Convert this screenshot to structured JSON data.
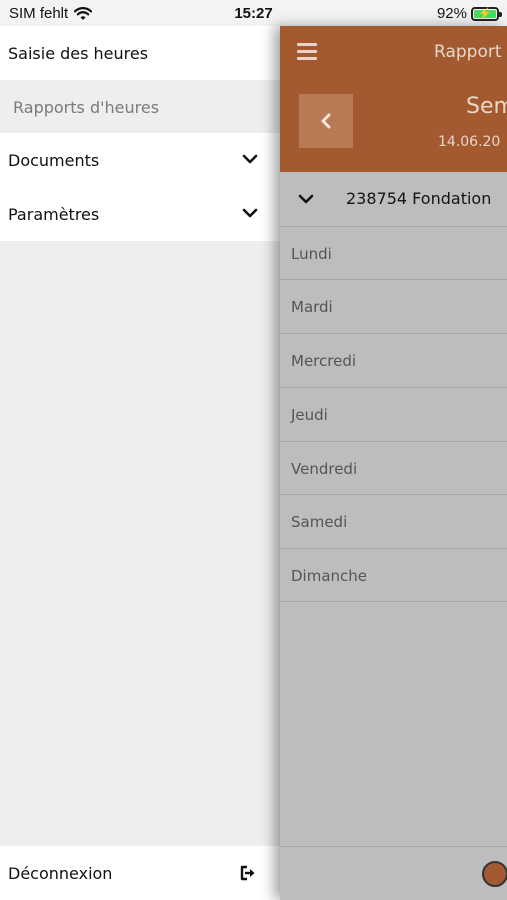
{
  "status_bar": {
    "carrier": "SIM fehlt",
    "time": "15:27",
    "battery_percent": "92%",
    "battery_level": 0.92,
    "icons": [
      "wifi-icon",
      "battery-charging-icon"
    ]
  },
  "drawer": {
    "items": [
      {
        "label": "Saisie des heures"
      },
      {
        "label": "Rapports d'heures"
      },
      {
        "label": "Documents",
        "icon": "chevron-down-icon"
      },
      {
        "label": "Paramètres",
        "icon": "chevron-down-icon"
      }
    ],
    "logout": {
      "label": "Déconnexion",
      "icon": "logout-icon"
    }
  },
  "main": {
    "header": {
      "title": "Rapport",
      "week_label": "Sem",
      "week_date": "14.06.20",
      "back_icon": "chevron-left-icon",
      "menu_icon": "hamburger-icon",
      "color": "#a35a30"
    },
    "project": {
      "label": "238754 Fondation",
      "icon": "chevron-down-icon"
    },
    "days": [
      "Lundi",
      "Mardi",
      "Mercredi",
      "Jeudi",
      "Vendredi",
      "Samedi",
      "Dimanche"
    ],
    "fab_color": "#a35a30"
  }
}
